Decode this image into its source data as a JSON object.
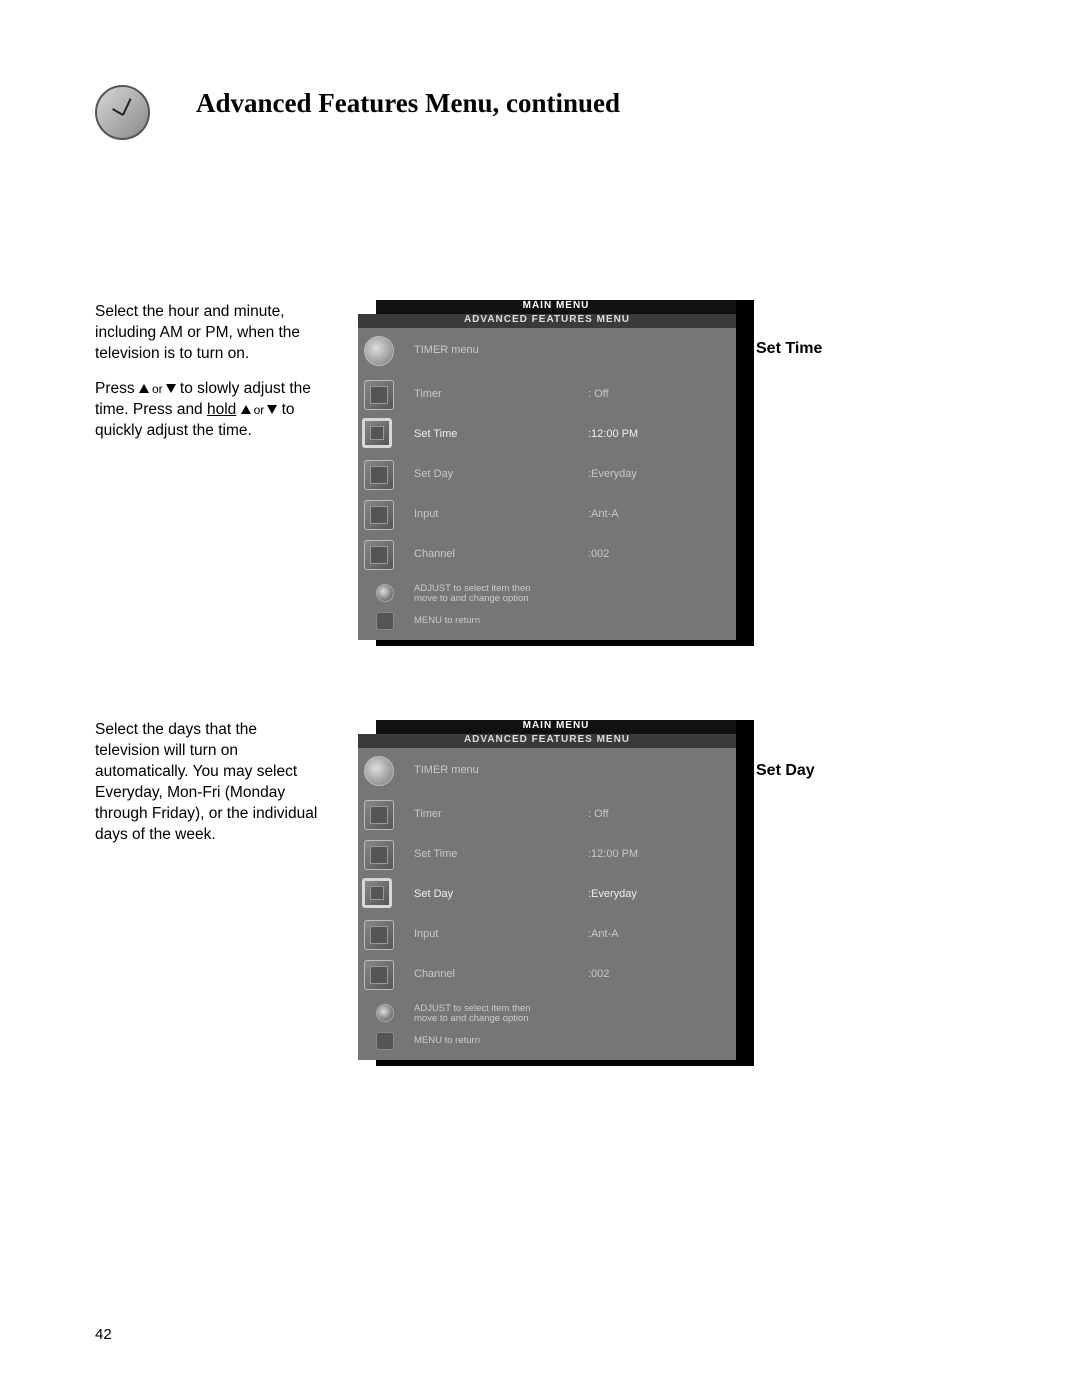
{
  "heading": "Advanced Features Menu, continued",
  "page_number": "42",
  "section1": {
    "side_label": "Set Time",
    "para1": "Select the hour and minute, including AM or PM,  when the television is to turn on.",
    "para2_pre": "Press ",
    "para2_mid1": " to slowly adjust the time.  Press and ",
    "para2_hold": "hold",
    "para2_mid2": " to quickly adjust the time."
  },
  "section2": {
    "side_label": "Set Day",
    "para1": "Select the days that the television will turn on automatically.  You may select Everyday, Mon-Fri (Monday through Friday), or the individual days of the week."
  },
  "tv": {
    "main_menu": "MAIN MENU",
    "sub_menu": "ADVANCED FEATURES MENU",
    "header_row": "TIMER menu",
    "rows": [
      {
        "label": "Timer",
        "value": ": Off"
      },
      {
        "label": "Set Time",
        "value": ":12:00 PM"
      },
      {
        "label": "Set Day",
        "value": ":Everyday"
      },
      {
        "label": "Input",
        "value": ":Ant-A"
      },
      {
        "label": "Channel",
        "value": ":002"
      }
    ],
    "footer_line1": "ADJUST to select item then",
    "footer_line2": "move to and change option",
    "footer_line3": "MENU to return"
  },
  "highlight": {
    "screenshot1": 1,
    "screenshot2": 2
  }
}
